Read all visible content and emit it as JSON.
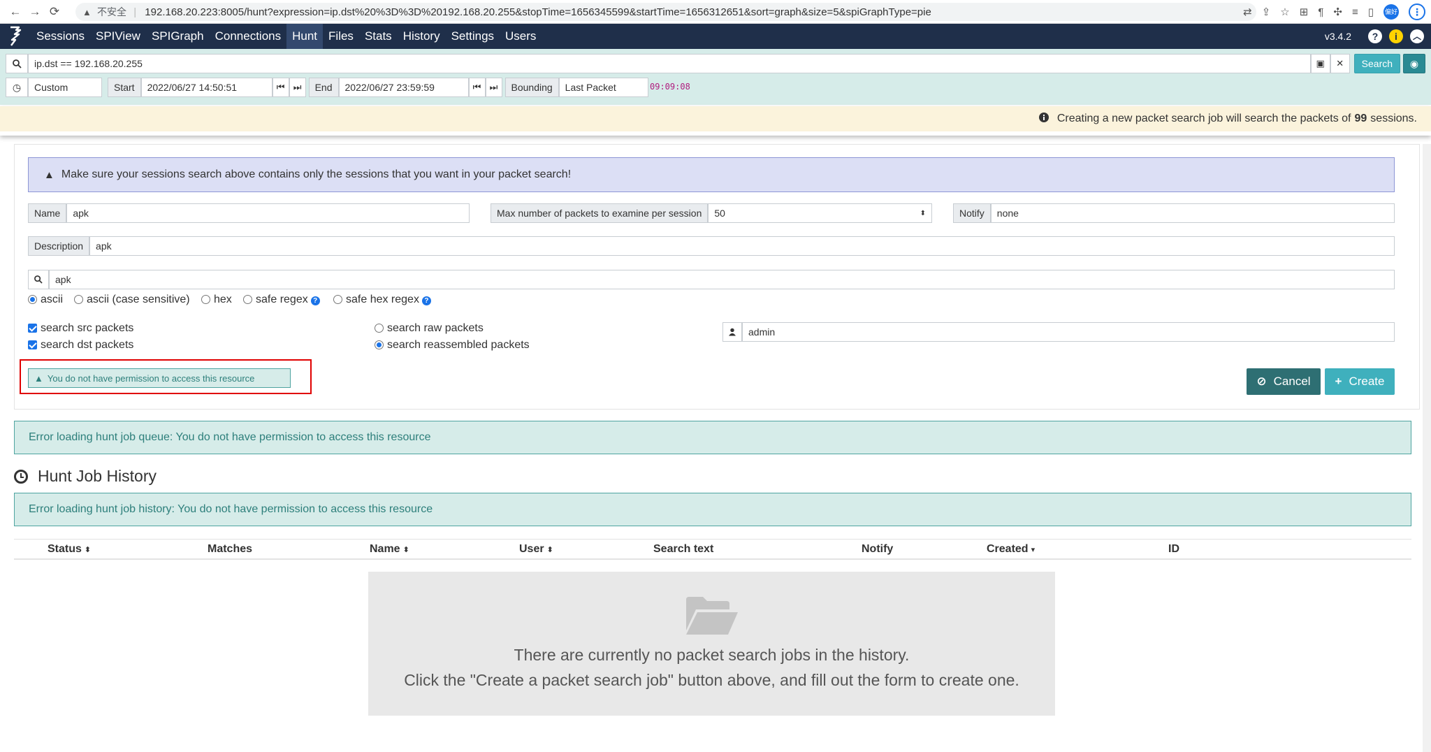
{
  "browser": {
    "not_secure": "不安全",
    "url": "192.168.20.223:8005/hunt?expression=ip.dst%20%3D%3D%20192.168.20.255&stopTime=1656345599&startTime=1656312651&sort=graph&size=5&spiGraphType=pie",
    "profile_badge": "偏好"
  },
  "nav": {
    "items": [
      "Sessions",
      "SPIView",
      "SPIGraph",
      "Connections",
      "Hunt",
      "Files",
      "Stats",
      "History",
      "Settings",
      "Users"
    ],
    "active": "Hunt",
    "version": "v3.4.2"
  },
  "search": {
    "expression": "ip.dst == 192.168.20.255",
    "button": "Search",
    "time_range": "Custom",
    "start_label": "Start",
    "start_value": "2022/06/27 14:50:51",
    "end_label": "End",
    "end_value": "2022/06/27 23:59:59",
    "bounding_label": "Bounding",
    "bounding_value": "Last Packet",
    "elapsed": "09:09:08"
  },
  "banner": {
    "prefix": "Creating a new packet search job will search the packets of",
    "count": "99",
    "suffix": "sessions."
  },
  "form": {
    "notice": "Make sure your sessions search above contains only the sessions that you want in your packet search!",
    "name_label": "Name",
    "name_value": "apk",
    "max_label": "Max number of packets to examine per session",
    "max_value": "50",
    "notify_label": "Notify",
    "notify_value": "none",
    "description_label": "Description",
    "description_value": "apk",
    "search_text": "apk",
    "search_types": [
      "ascii",
      "ascii (case sensitive)",
      "hex",
      "safe regex",
      "safe hex regex"
    ],
    "selected_type": "ascii",
    "src_label": "search src packets",
    "dst_label": "search dst packets",
    "raw_label": "search raw packets",
    "reassembled_label": "search reassembled packets",
    "user_value": "admin",
    "permission_error": "You do not have permission to access this resource",
    "cancel": "Cancel",
    "create": "Create"
  },
  "errors": {
    "queue": "Error loading hunt job queue: You do not have permission to access this resource",
    "history": "Error loading hunt job history: You do not have permission to access this resource"
  },
  "history": {
    "title": "Hunt Job History",
    "columns": [
      "Status",
      "Matches",
      "Name",
      "User",
      "Search text",
      "Notify",
      "Created",
      "ID"
    ],
    "empty_line1": "There are currently no packet search jobs in the history.",
    "empty_line2": "Click the \"Create a packet search job\" button above, and fill out the form to create one."
  },
  "colors": {
    "navbar": "#1f2f4a",
    "accent": "#3fb0bd",
    "alert_teal": "#d6ece9",
    "alert_purple": "#dcdff5",
    "highlight_red": "#e00000"
  }
}
